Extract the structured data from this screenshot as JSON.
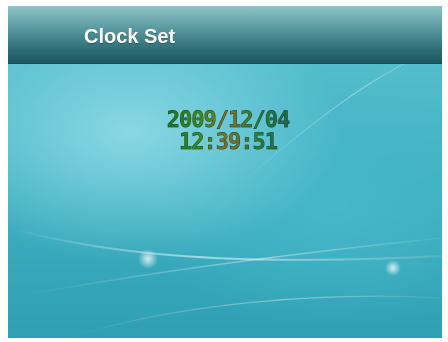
{
  "header": {
    "title": "Clock Set"
  },
  "clock": {
    "date": "2009/12/04",
    "time": "12:39:51"
  },
  "colors": {
    "background": "#4fbccb",
    "title_bar": "#2f6f77",
    "title_text": "#ffffff",
    "digits": "#2a7a36"
  }
}
